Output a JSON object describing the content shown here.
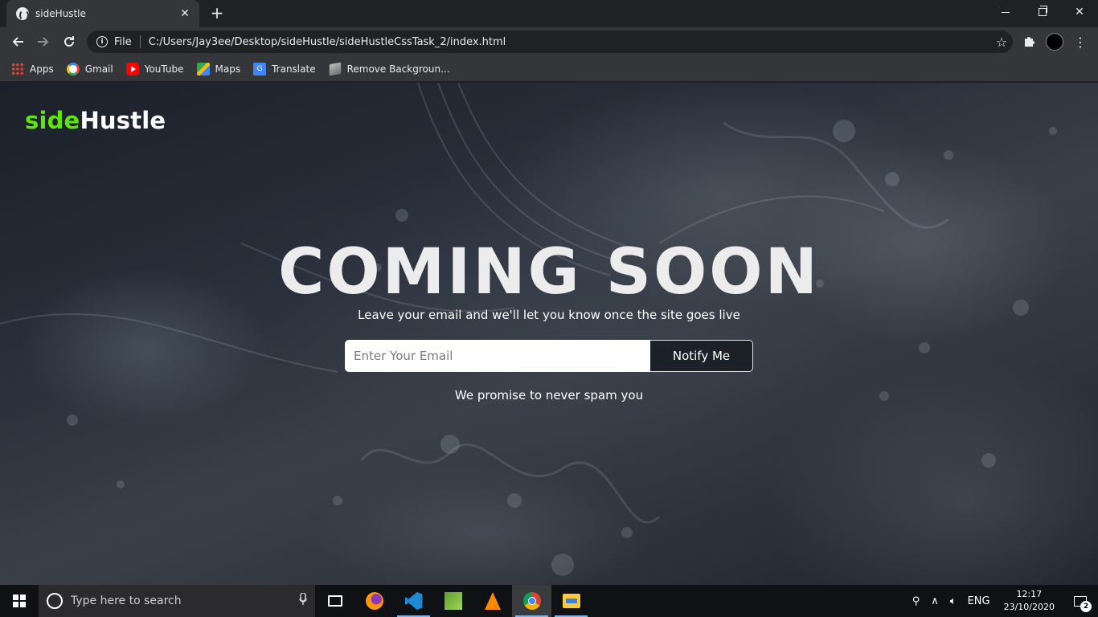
{
  "browser": {
    "tab_title": "sideHustle",
    "url_chip": "File",
    "url": "C:/Users/Jay3ee/Desktop/sideHustle/sideHustleCssTask_2/index.html",
    "bookmarks": [
      "Apps",
      "Gmail",
      "YouTube",
      "Maps",
      "Translate",
      "Remove Backgroun..."
    ]
  },
  "page": {
    "logo_part1": "side",
    "logo_part2": "Hustle",
    "logo_colors": {
      "part1": "#5ee40e",
      "part2": "#ffffff"
    },
    "title": "COMING SOON",
    "subtitle": "Leave your email and we'll let you know once the site goes live",
    "email_placeholder": "Enter Your Email",
    "notify_label": "Notify Me",
    "promise": "We promise to never spam you"
  },
  "taskbar": {
    "search_placeholder": "Type here to search",
    "apps": [
      "task-view",
      "firefox",
      "vscode",
      "qgis",
      "vlc",
      "chrome",
      "file-explorer"
    ],
    "language": "ENG",
    "time": "12:17",
    "date": "23/10/2020",
    "notification_count": "2"
  }
}
